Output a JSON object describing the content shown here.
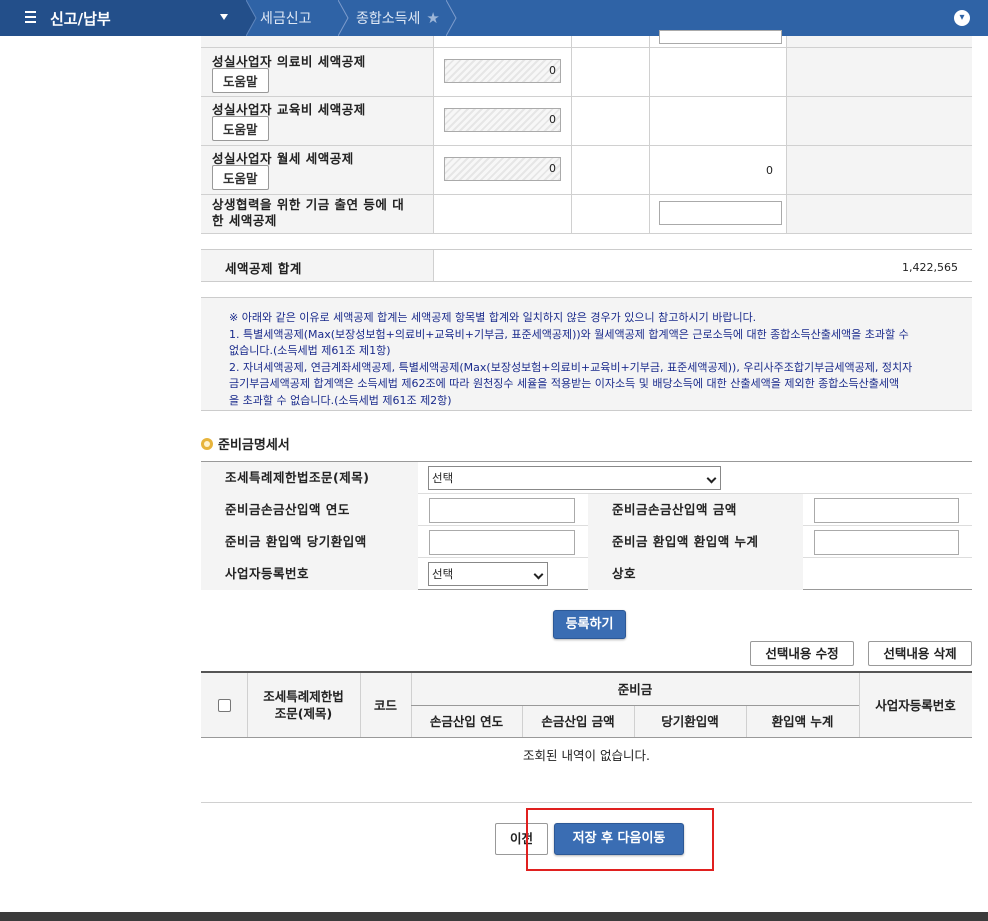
{
  "nav": {
    "menu_title": "신고/납부",
    "crumb1": "세금신고",
    "crumb2": "종합소득세"
  },
  "credits": {
    "help_label": "도움말",
    "rows": [
      {
        "label": "성실사업자 의료비 세액공제",
        "amount": "0",
        "result": ""
      },
      {
        "label": "성실사업자 교육비 세액공제",
        "amount": "0",
        "result": ""
      },
      {
        "label": "성실사업자 월세 세액공제",
        "amount": "0",
        "result": "0"
      }
    ],
    "coop_label_1": "상생협력을 위한 기금 출연 등에 대",
    "coop_label_2": "한 세액공제",
    "total_label": "세액공제 합계",
    "total_value": "1,422,565"
  },
  "notice": {
    "line1": "※ 아래와 같은 이유로 세액공제 합계는 세액공제 항목별 합계와 일치하지 않은 경우가 있으니 참고하시기 바랍니다.",
    "line2": "1. 특별세액공제(Max(보장성보험+의료비+교육비+기부금, 표준세액공제))와 월세액공제 합계액은 근로소득에 대한 종합소득산출세액을 초과할 수",
    "line3": "없습니다.(소득세법 제61조 제1항)",
    "line4": "2. 자녀세액공제, 연금계좌세액공제, 특별세액공제(Max(보장성보험+의료비+교육비+기부금, 표준세액공제)), 우리사주조합기부금세액공제, 정치자",
    "line5": "금기부금세액공제 합계액은 소득세법 제62조에 따라 원천징수 세율을 적용받는 이자소득 및 배당소득에 대한 산출세액을 제외한 종합소득산출세액",
    "line6": "을 초과할 수 없습니다.(소득세법 제61조 제2항)"
  },
  "reserve": {
    "section_title": "준비금명세서",
    "law_label": "조세특례제한법조문(제목)",
    "law_select": "선택",
    "year_label": "준비금손금산입액 연도",
    "amount_label": "준비금손금산입액 금액",
    "current_label": "준비금 환입액 당기환입액",
    "cumulative_label": "준비금 환입액 환입액 누계",
    "bizno_label": "사업자등록번호",
    "bizno_select": "선택",
    "name_label": "상호",
    "register_button": "등록하기",
    "edit_button": "선택내용 수정",
    "delete_button": "선택내용 삭제"
  },
  "list": {
    "col_law_1": "조세특례제한법",
    "col_law_2": "조문(제목)",
    "col_code": "코드",
    "col_group": "준비금",
    "col_year": "손금산입 연도",
    "col_amount": "손금산입 금액",
    "col_current": "당기환입액",
    "col_cumulative": "환입액 누계",
    "col_bizno": "사업자등록번호",
    "empty_message": "조회된 내역이 없습니다."
  },
  "footer": {
    "prev_button": "이전",
    "save_next_button": "저장 후 다음이동"
  }
}
